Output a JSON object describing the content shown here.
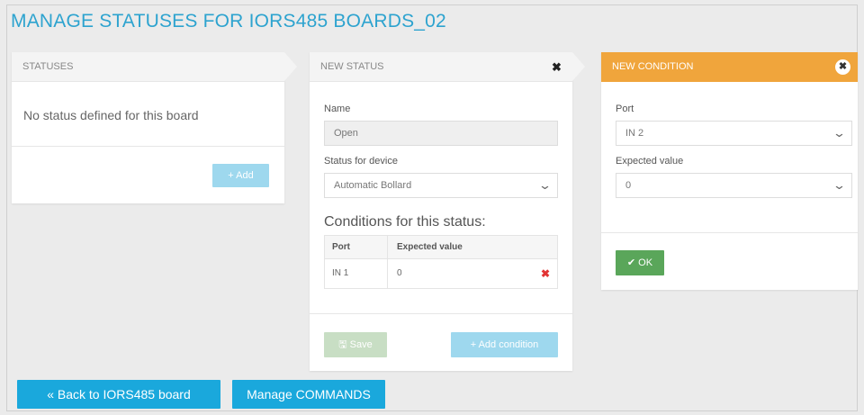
{
  "page": {
    "title": "MANAGE STATUSES FOR IORS485 BOARDS_02"
  },
  "statuses_panel": {
    "header": "STATUSES",
    "empty_message": "No status defined for this board",
    "add_label": "+ Add"
  },
  "new_status_panel": {
    "header": "NEW STATUS",
    "close_glyph": "✖",
    "name_label": "Name",
    "name_value": "Open",
    "device_label": "Status for device",
    "device_value": "Automatic Bollard",
    "conditions_title": "Conditions for this status:",
    "table": {
      "columns": [
        "Port",
        "Expected value"
      ],
      "rows": [
        {
          "port": "IN 1",
          "value": "0"
        }
      ]
    },
    "save_label": "🖫 Save",
    "add_condition_label": "+ Add condition"
  },
  "new_condition_panel": {
    "header": "NEW CONDITION",
    "close_glyph": "✖",
    "port_label": "Port",
    "port_value": "IN 2",
    "expected_label": "Expected value",
    "expected_value": "0",
    "ok_label": "✔ OK"
  },
  "footer": {
    "back_label": "«  Back to IORS485 board",
    "commands_label": "Manage COMMANDS"
  },
  "icons": {
    "chevron": "chevron-down-icon",
    "delete": "close-icon",
    "save": "floppy-icon",
    "plus": "plus-icon",
    "check": "check-icon"
  },
  "colors": {
    "title": "#2da3cf",
    "accent_orange": "#f0a53c",
    "primary_blue": "#1aa8dc",
    "ok_green": "#5aa65a",
    "delete_red": "#e23434"
  }
}
